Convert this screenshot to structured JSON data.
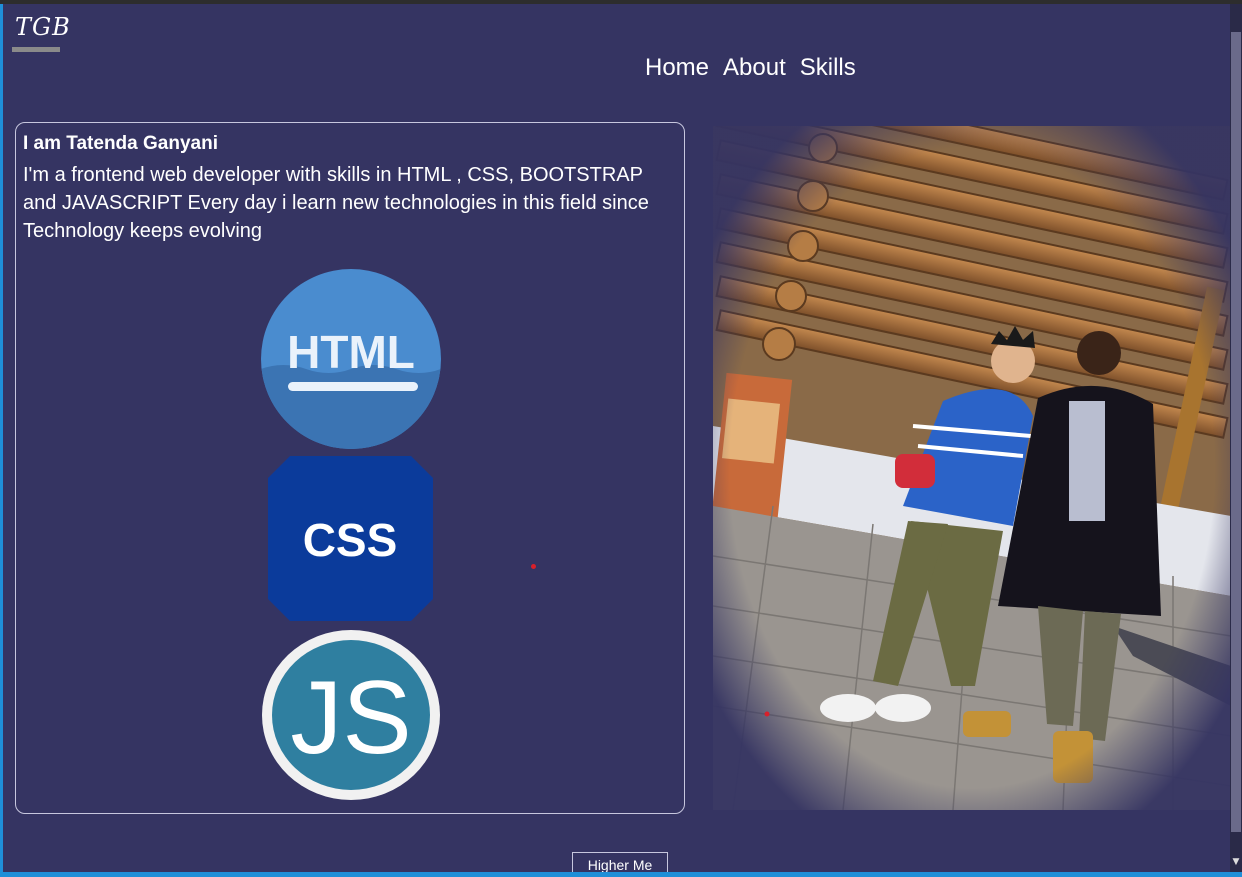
{
  "header": {
    "logo": "TGB",
    "nav": [
      "Home",
      "About",
      "Skills"
    ]
  },
  "intro": {
    "name": "I am Tatenda Ganyani",
    "bio": "I'm a frontend web developer with skills in HTML , CSS, BOOTSTRAP and JAVASCRIPT Every day i learn new technologies in this field since Technology keeps evolving"
  },
  "skills": {
    "html_label": "HTML",
    "css_label": "CSS",
    "js_label": "JS"
  },
  "photo": {
    "icon": "profile-photo"
  },
  "cta": {
    "hire_label": "Higher Me"
  },
  "colors": {
    "background": "#353462",
    "accent": "#1f8fd8",
    "html_icon": "#4a8ccf",
    "css_icon": "#0b3b9b",
    "js_icon": "#2f7fa0"
  }
}
